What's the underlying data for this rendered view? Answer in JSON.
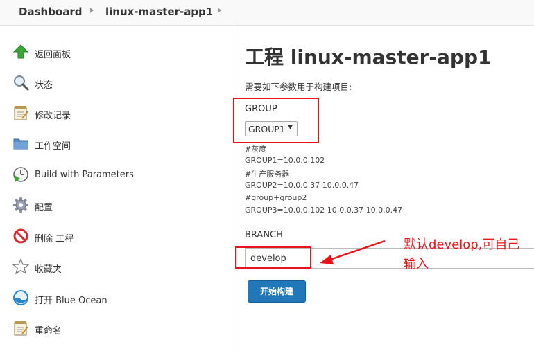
{
  "breadcrumb": {
    "items": [
      "Dashboard",
      "linux-master-app1"
    ]
  },
  "sidebar": {
    "items": [
      {
        "label": "返回面板",
        "icon": "up-arrow-icon"
      },
      {
        "label": "状态",
        "icon": "magnifier-icon"
      },
      {
        "label": "修改记录",
        "icon": "notepad-icon"
      },
      {
        "label": "工作空间",
        "icon": "folder-icon"
      },
      {
        "label": "Build with Parameters",
        "icon": "build-clock-icon"
      },
      {
        "label": "配置",
        "icon": "gear-icon"
      },
      {
        "label": "删除 工程",
        "icon": "no-entry-icon"
      },
      {
        "label": "收藏夹",
        "icon": "star-icon"
      },
      {
        "label": "打开 Blue Ocean",
        "icon": "blue-ocean-icon"
      },
      {
        "label": "重命名",
        "icon": "notepad-icon"
      }
    ]
  },
  "main": {
    "title": "工程 linux-master-app1",
    "description": "需要如下参数用于构建项目:",
    "group": {
      "label": "GROUP",
      "selected": "GROUP1",
      "description_lines": [
        "#灰度",
        "GROUP1=10.0.0.102",
        "#生产服务器",
        "GROUP2=10.0.0.37 10.0.0.47",
        "#group+group2",
        "GROUP3=10.0.0.102 10.0.0.37 10.0.0.47"
      ]
    },
    "branch": {
      "label": "BRANCH",
      "value": "develop"
    },
    "build_button": "开始构建"
  },
  "annotation": {
    "text": "默认develop,可自己输入",
    "color": "#e8141a"
  },
  "colors": {
    "accent": "#2277b8",
    "annotation_red": "#e8141a"
  }
}
